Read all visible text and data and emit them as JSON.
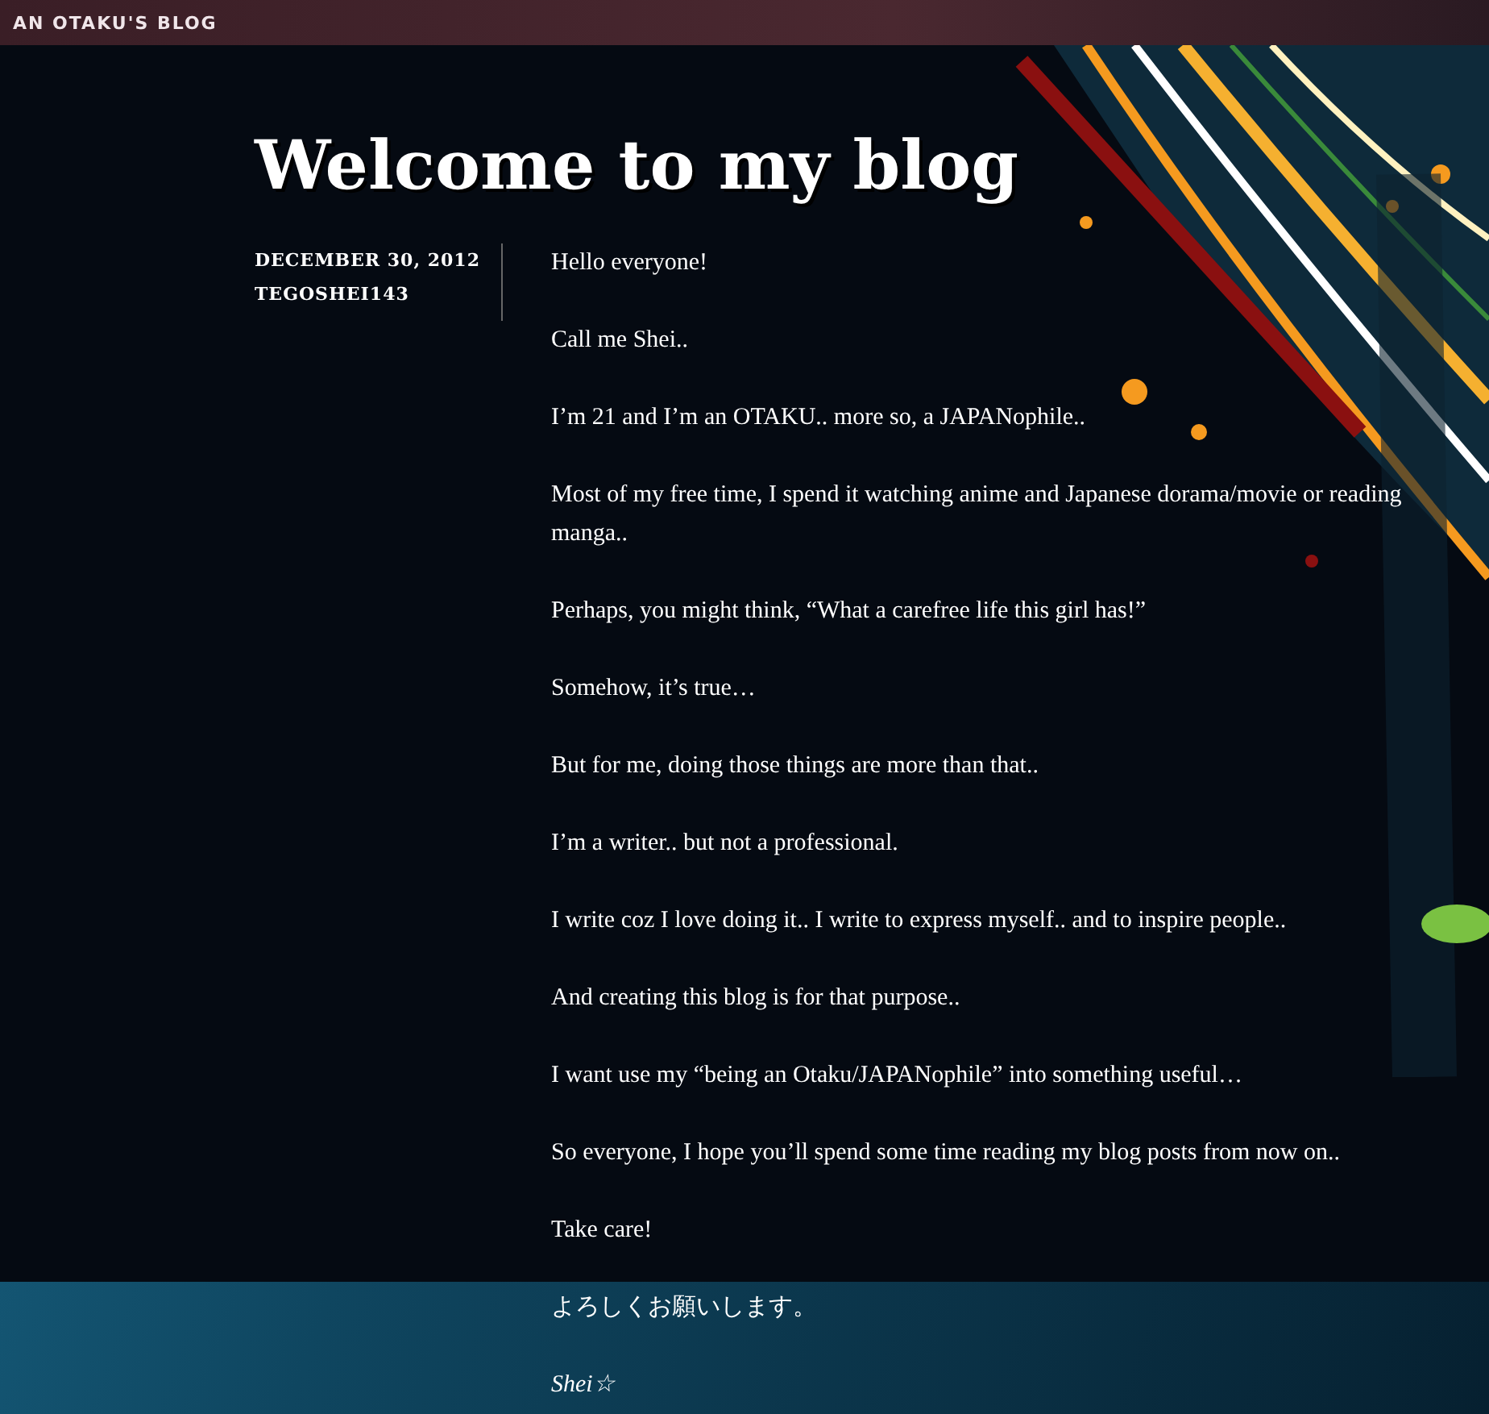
{
  "site_title": "AN OTAKU'S BLOG",
  "post": {
    "title": "Welcome to my blog",
    "date": "DECEMBER 30, 2012",
    "author": "TEGOSHEI143",
    "paragraphs": [
      {
        "kind": "text",
        "text": "Hello everyone!"
      },
      {
        "kind": "text",
        "text": "Call me Shei.."
      },
      {
        "kind": "text",
        "text": "I’m 21 and I’m an OTAKU.. more so, a JAPANophile.."
      },
      {
        "kind": "text",
        "text": "Most of my free time, I spend it watching anime and Japanese dorama/movie or reading manga.."
      },
      {
        "kind": "text",
        "text": "Perhaps, you might think, “What a carefree life this girl has!”"
      },
      {
        "kind": "text",
        "text": "Somehow, it’s true…"
      },
      {
        "kind": "text",
        "text": "But for me, doing those things are more than that.."
      },
      {
        "kind": "text",
        "text": "I’m a writer.. but not a professional."
      },
      {
        "kind": "text",
        "text": "I write coz I love doing it.. I write to express myself.. and to inspire people.."
      },
      {
        "kind": "text",
        "text": "And creating this blog is for that purpose.."
      },
      {
        "kind": "text",
        "text": "I want use my “being an Otaku/JAPANophile” into something useful…"
      },
      {
        "kind": "text",
        "text": "So everyone, I hope you’ll spend some time reading my blog posts from now on.."
      },
      {
        "kind": "text",
        "text": "Take care!"
      },
      {
        "kind": "text",
        "text": "よろしくお願いします。"
      },
      {
        "kind": "signature",
        "text": "Shei☆"
      }
    ]
  }
}
